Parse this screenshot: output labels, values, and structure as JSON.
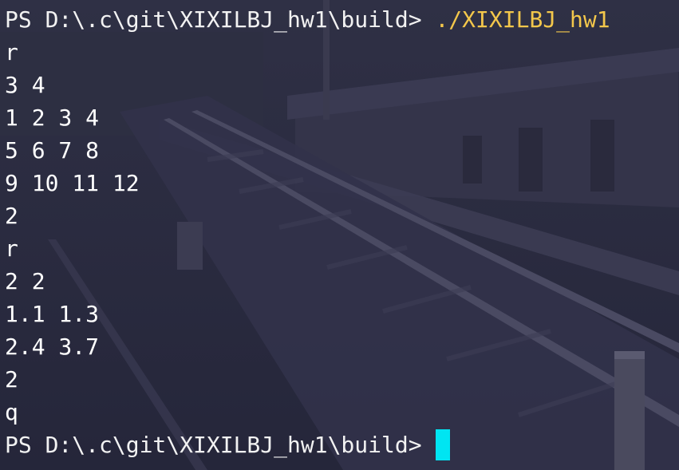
{
  "terminal": {
    "prompt": "PS D:\\.c\\git\\XIXILBJ_hw1\\build>",
    "command": "./XIXILBJ_hw1",
    "output_lines": [
      "r",
      "3 4",
      "1 2 3 4",
      "5 6 7 8",
      "9 10 11 12",
      "2",
      "r",
      "2 2",
      "1.1 1.3",
      "2.4 3.7",
      "2",
      "q"
    ],
    "final_prompt": "PS D:\\.c\\git\\XIXILBJ_hw1\\build>"
  },
  "colors": {
    "text": "#ffffff",
    "command": "#f3c74b",
    "cursor": "#00e5f2",
    "background": "#2b2c3f"
  },
  "icons": {
    "cursor": "block-cursor-icon"
  }
}
